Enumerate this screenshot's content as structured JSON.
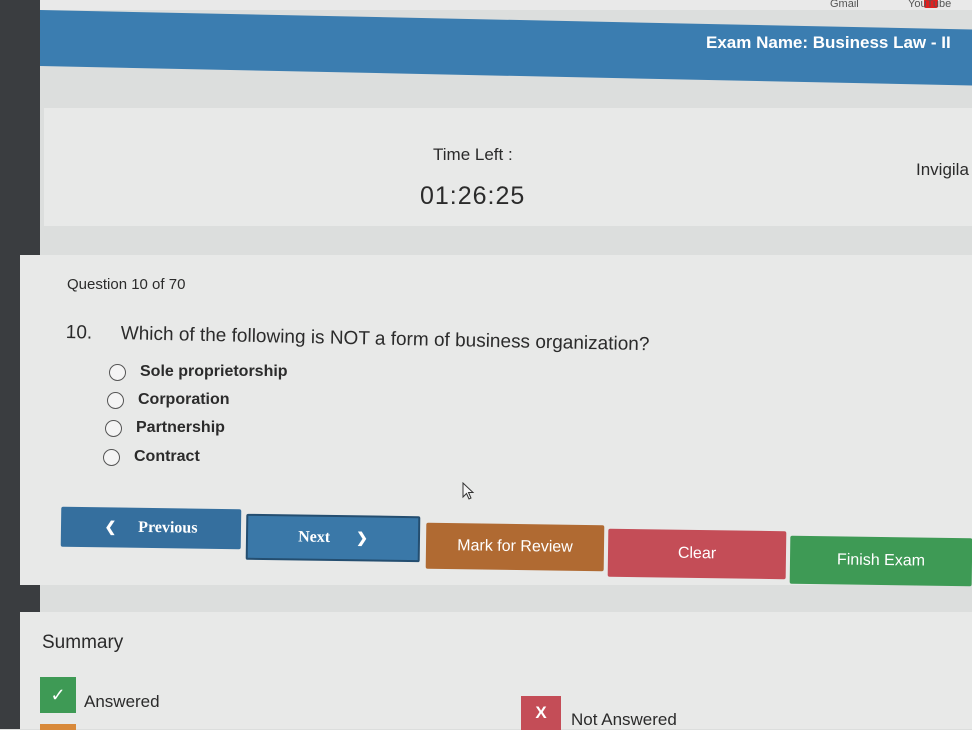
{
  "browser": {
    "bookmark_gmail": "Gmail",
    "bookmark_youtube": "YouTube"
  },
  "header": {
    "exam_name": "Exam Name: Business Law - II"
  },
  "timer": {
    "label": "Time Left :",
    "value": "01:26:25"
  },
  "invigilator": {
    "label": "Invigila"
  },
  "question": {
    "counter": "Question 10 of 70",
    "number": "10.",
    "text": "Which of the following is NOT a form of business organization?",
    "options": [
      "Sole proprietorship",
      "Corporation",
      "Partnership",
      "Contract"
    ]
  },
  "actions": {
    "previous": "Previous",
    "next": "Next",
    "mark_for_review": "Mark for Review",
    "clear": "Clear",
    "finish": "Finish Exam"
  },
  "summary": {
    "title": "Summary",
    "answered_label": "Answered",
    "answered_icon": "✓",
    "not_answered_label": "Not Answered",
    "not_answered_icon": "X"
  }
}
